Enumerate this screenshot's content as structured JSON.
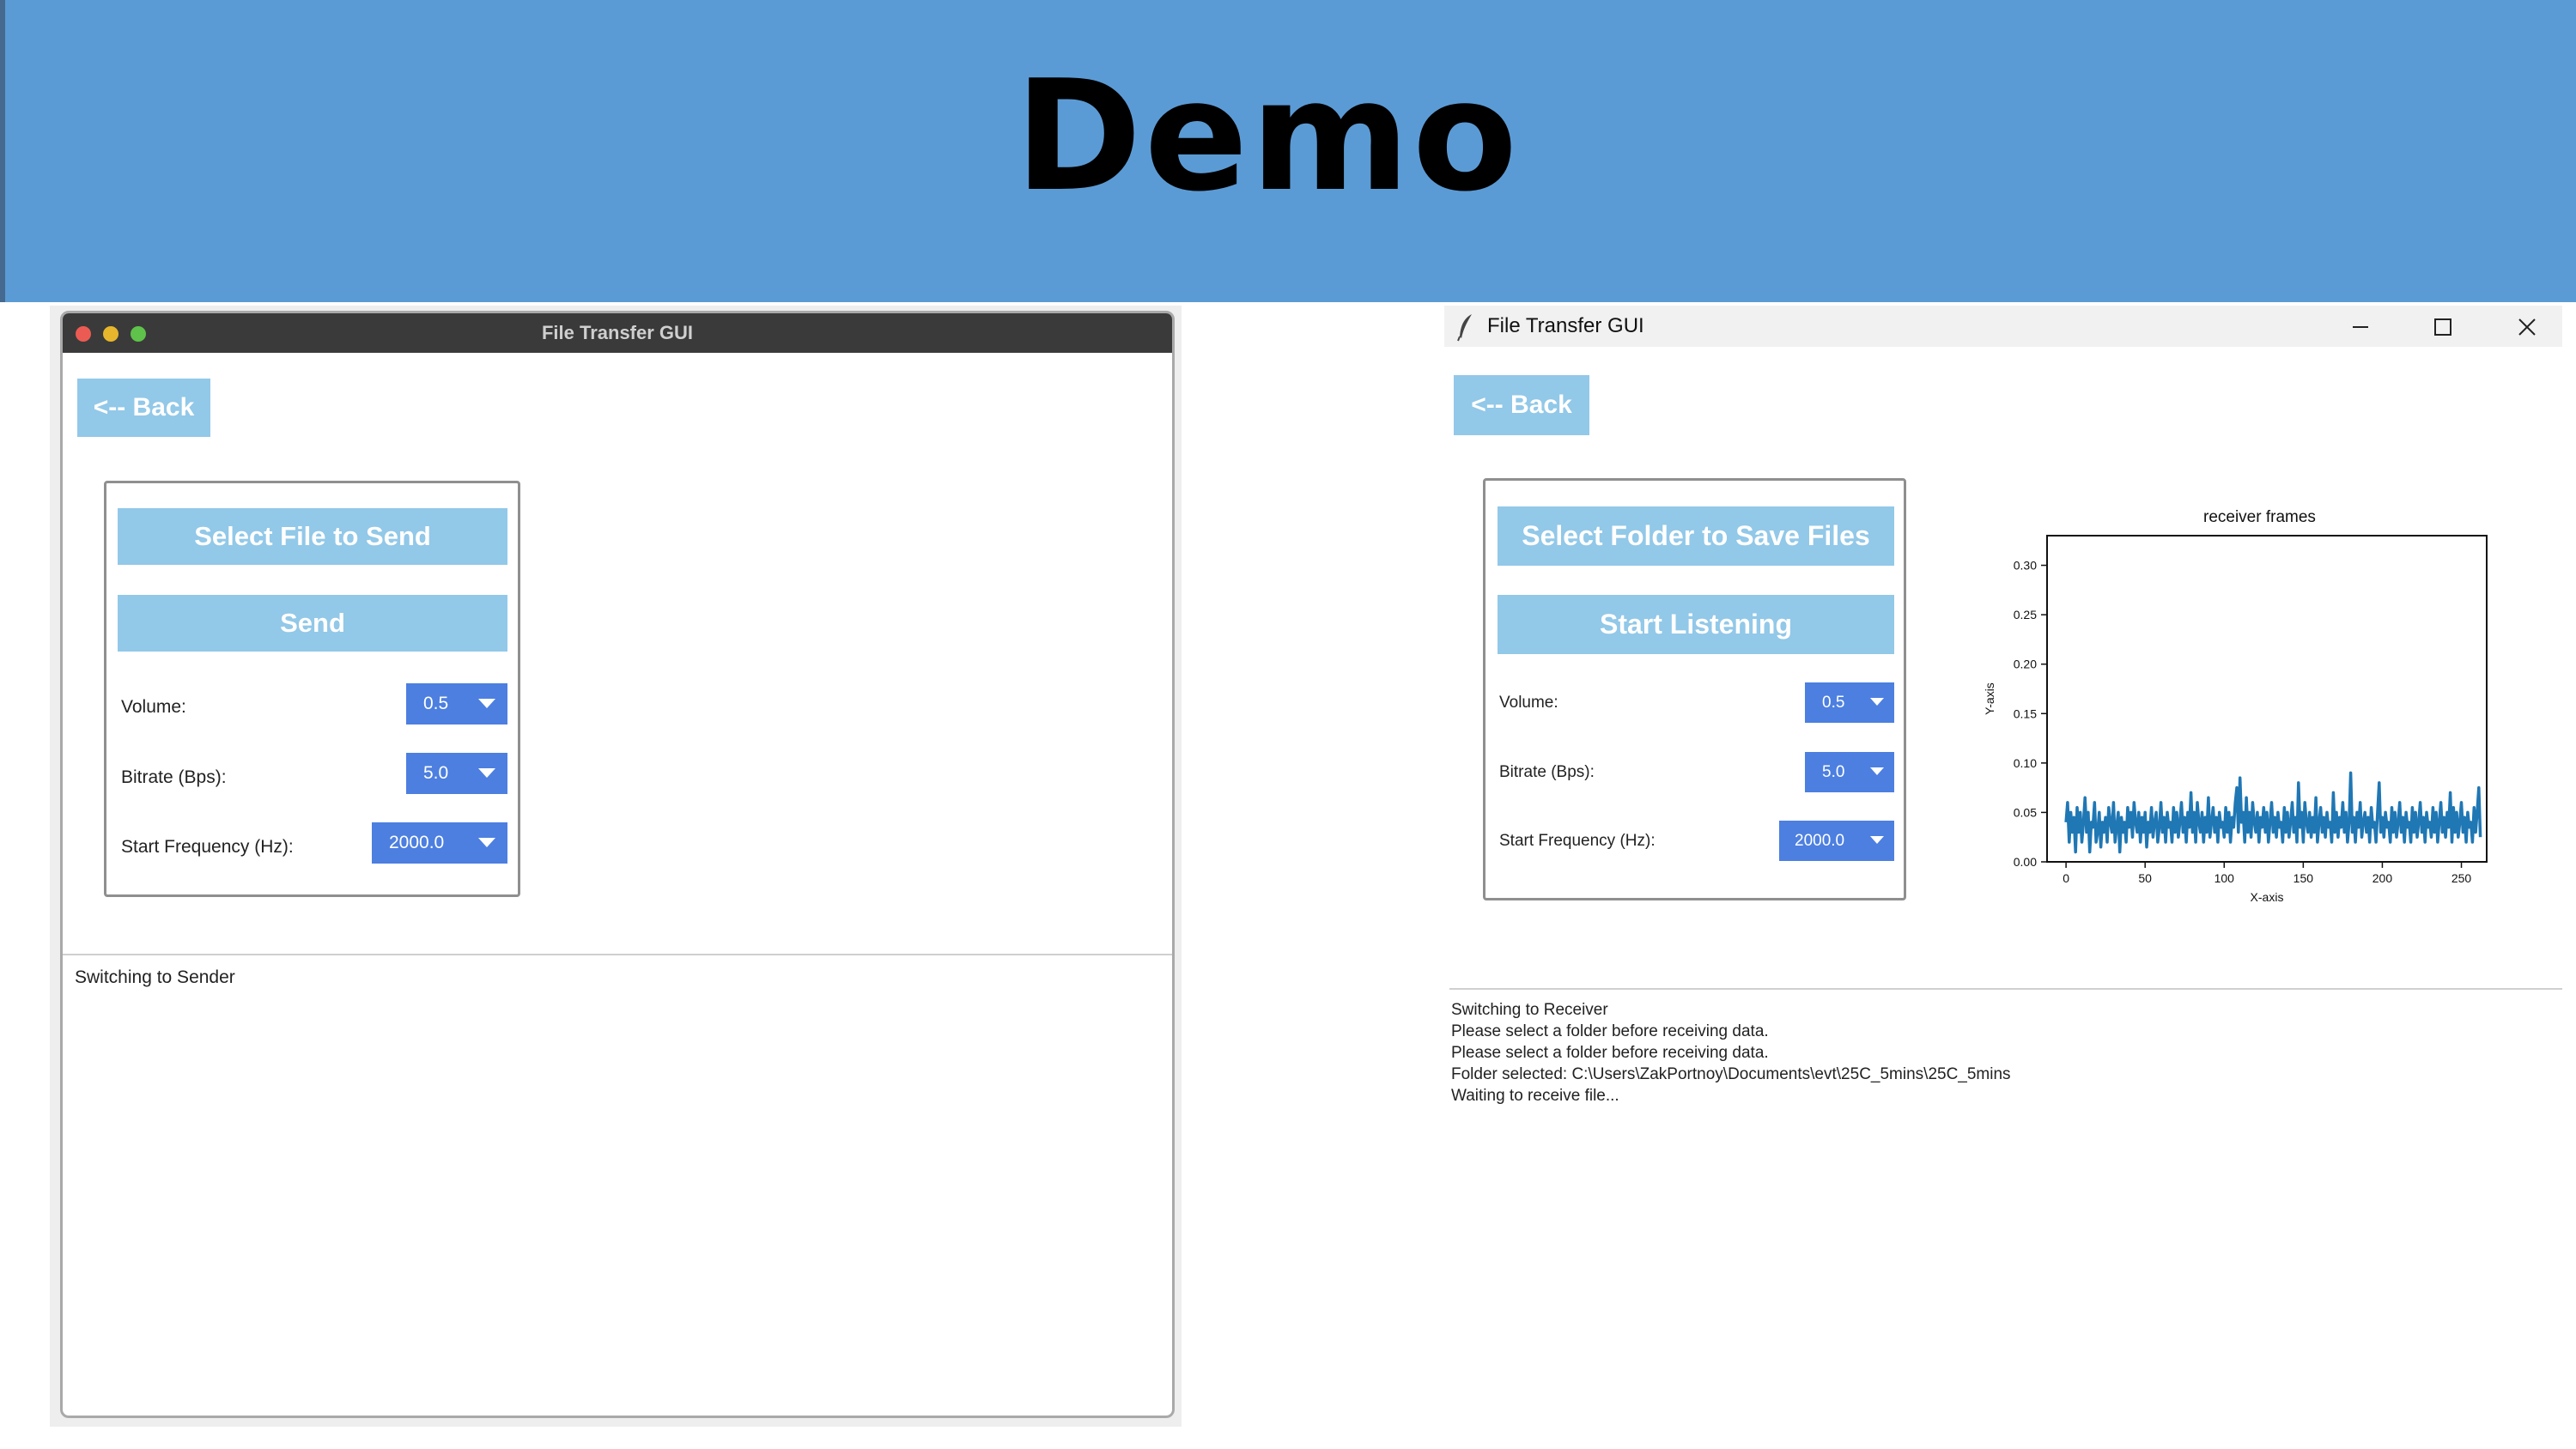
{
  "banner": {
    "title": "Demo"
  },
  "sender": {
    "window_title": "File Transfer GUI",
    "back_label": "<-- Back",
    "select_label": "Select File to Send",
    "send_label": "Send",
    "volume_label": "Volume:",
    "volume_value": "0.5",
    "bitrate_label": "Bitrate (Bps):",
    "bitrate_value": "5.0",
    "freq_label": "Start Frequency (Hz):",
    "freq_value": "2000.0",
    "log": [
      "Switching to Sender"
    ]
  },
  "receiver": {
    "window_title": "File Transfer GUI",
    "back_label": "<-- Back",
    "select_label": "Select Folder to Save Files",
    "listen_label": "Start Listening",
    "volume_label": "Volume:",
    "volume_value": "0.5",
    "bitrate_label": "Bitrate (Bps):",
    "bitrate_value": "5.0",
    "freq_label": "Start Frequency (Hz):",
    "freq_value": "2000.0",
    "log": [
      "Switching to Receiver",
      "Please select a folder before receiving data.",
      "Please select a folder before receiving data.",
      "Folder selected: C:\\Users\\ZakPortnoy\\Documents\\evt\\25C_5mins\\25C_5mins",
      "Waiting to receive file..."
    ]
  },
  "colors": {
    "banner": "#5b9bd5",
    "button_light": "#92c8e8",
    "dropdown": "#4c7fe0",
    "plot_line": "#1f77b4"
  },
  "icons": {
    "mac_close": "red-dot",
    "mac_minimize": "yellow-dot",
    "mac_zoom": "green-dot",
    "app_icon": "feather-icon",
    "minimize": "minimize-icon",
    "maximize": "maximize-icon",
    "close": "close-icon"
  },
  "chart_data": {
    "type": "line",
    "title": "receiver frames",
    "xlabel": "X-axis",
    "ylabel": "Y-axis",
    "xlim": [
      -12,
      266
    ],
    "ylim": [
      0,
      0.33
    ],
    "xticks": [
      "0",
      "50",
      "100",
      "150",
      "200",
      "250"
    ],
    "yticks": [
      "0.00",
      "0.05",
      "0.10",
      "0.15",
      "0.20",
      "0.25",
      "0.30"
    ],
    "grid": false,
    "series": [
      {
        "values": [
          0.04,
          0.06,
          0.02,
          0.05,
          0.03,
          0.045,
          0.01,
          0.055,
          0.03,
          0.05,
          0.02,
          0.04,
          0.065,
          0.03,
          0.05,
          0.01,
          0.04,
          0.035,
          0.06,
          0.02,
          0.03,
          0.05,
          0.015,
          0.04,
          0.03,
          0.045,
          0.02,
          0.055,
          0.04,
          0.03,
          0.06,
          0.02,
          0.035,
          0.05,
          0.01,
          0.045,
          0.03,
          0.04,
          0.02,
          0.055,
          0.035,
          0.05,
          0.025,
          0.06,
          0.04,
          0.03,
          0.05,
          0.02,
          0.045,
          0.03,
          0.05,
          0.015,
          0.04,
          0.03,
          0.055,
          0.025,
          0.04,
          0.05,
          0.02,
          0.035,
          0.06,
          0.03,
          0.045,
          0.02,
          0.05,
          0.035,
          0.04,
          0.02,
          0.055,
          0.03,
          0.05,
          0.025,
          0.04,
          0.06,
          0.03,
          0.045,
          0.02,
          0.05,
          0.035,
          0.07,
          0.03,
          0.05,
          0.02,
          0.06,
          0.04,
          0.03,
          0.05,
          0.02,
          0.045,
          0.03,
          0.065,
          0.025,
          0.04,
          0.055,
          0.03,
          0.045,
          0.02,
          0.05,
          0.035,
          0.04,
          0.025,
          0.055,
          0.03,
          0.05,
          0.02,
          0.045,
          0.035,
          0.06,
          0.075,
          0.03,
          0.085,
          0.04,
          0.05,
          0.02,
          0.065,
          0.03,
          0.05,
          0.025,
          0.06,
          0.04,
          0.03,
          0.05,
          0.02,
          0.045,
          0.035,
          0.055,
          0.03,
          0.05,
          0.02,
          0.04,
          0.06,
          0.03,
          0.045,
          0.025,
          0.05,
          0.035,
          0.04,
          0.02,
          0.055,
          0.03,
          0.05,
          0.025,
          0.04,
          0.06,
          0.03,
          0.045,
          0.02,
          0.08,
          0.035,
          0.05,
          0.02,
          0.06,
          0.04,
          0.03,
          0.05,
          0.025,
          0.045,
          0.03,
          0.065,
          0.02,
          0.04,
          0.055,
          0.03,
          0.045,
          0.025,
          0.05,
          0.035,
          0.04,
          0.02,
          0.07,
          0.03,
          0.05,
          0.025,
          0.045,
          0.035,
          0.06,
          0.03,
          0.05,
          0.02,
          0.04,
          0.09,
          0.03,
          0.045,
          0.02,
          0.05,
          0.035,
          0.06,
          0.025,
          0.04,
          0.05,
          0.03,
          0.045,
          0.02,
          0.055,
          0.035,
          0.04,
          0.02,
          0.05,
          0.08,
          0.03,
          0.045,
          0.025,
          0.05,
          0.035,
          0.04,
          0.02,
          0.055,
          0.03,
          0.05,
          0.025,
          0.04,
          0.06,
          0.03,
          0.045,
          0.02,
          0.05,
          0.035,
          0.04,
          0.02,
          0.055,
          0.03,
          0.05,
          0.025,
          0.04,
          0.06,
          0.03,
          0.045,
          0.02,
          0.05,
          0.035,
          0.04,
          0.025,
          0.055,
          0.03,
          0.05,
          0.02,
          0.04,
          0.06,
          0.03,
          0.045,
          0.025,
          0.05,
          0.035,
          0.07,
          0.02,
          0.055,
          0.03,
          0.05,
          0.025,
          0.04,
          0.06,
          0.03,
          0.045,
          0.02,
          0.05,
          0.035,
          0.04,
          0.02,
          0.055,
          0.03,
          0.05,
          0.075,
          0.025
        ]
      }
    ]
  }
}
